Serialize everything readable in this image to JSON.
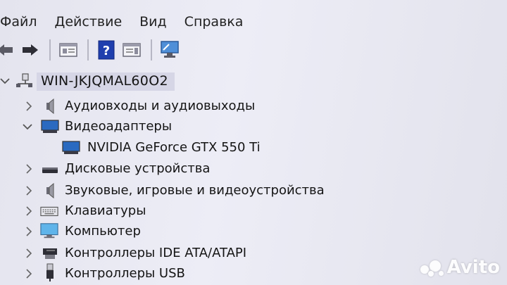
{
  "menu": [
    "Файл",
    "Действие",
    "Вид",
    "Справка"
  ],
  "toolbar": {
    "icons": [
      "back-arrow-icon",
      "forward-arrow-icon",
      "properties-icon",
      "help-icon",
      "action-pane-icon",
      "monitor-scan-icon"
    ]
  },
  "tree": {
    "root": "WIN-JKJQMAL60O2",
    "items": [
      {
        "label": "Аудиовходы и аудиовыходы",
        "expanded": false,
        "icon": "speaker-icon"
      },
      {
        "label": "Видеоадаптеры",
        "expanded": true,
        "icon": "display-adapter-icon"
      },
      {
        "label": "NVIDIA GeForce GTX 550 Ti",
        "child": true,
        "icon": "display-adapter-icon"
      },
      {
        "label": "Дисковые устройства",
        "expanded": false,
        "icon": "disk-drive-icon"
      },
      {
        "label": "Звуковые, игровые и видеоустройства",
        "expanded": false,
        "icon": "speaker-icon"
      },
      {
        "label": "Клавиатуры",
        "expanded": false,
        "icon": "keyboard-icon"
      },
      {
        "label": "Компьютер",
        "expanded": false,
        "icon": "computer-icon"
      },
      {
        "label": "Контроллеры IDE ATA/ATAPI",
        "expanded": false,
        "icon": "ide-controller-icon"
      },
      {
        "label": "Контроллеры USB",
        "expanded": false,
        "icon": "usb-icon"
      }
    ]
  },
  "watermark": "Avito"
}
